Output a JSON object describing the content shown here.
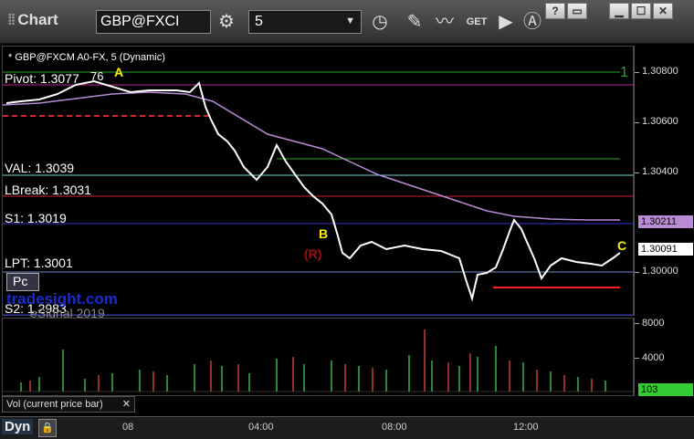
{
  "toolbar": {
    "title": "Chart",
    "symbol": "GBP@FXCI",
    "interval": "5",
    "get_label": "GET"
  },
  "chart_header": "* GBP@FXCM A0-FX, 5 (Dynamic)",
  "levels": {
    "pivot": "Pivot: 1.3077",
    "pivot_suffix": "76",
    "val": "VAL: 1.3039",
    "lbreak": "LBreak: 1.3031",
    "s1": "S1: 1.3019",
    "lpt": "LPT: 1.3001",
    "s2": "S2: 1.2983"
  },
  "annotations": {
    "a": "A",
    "b": "B",
    "c": "C",
    "r": "(R)",
    "right_one": "1",
    "pc": "Pc",
    "watermark": "tradesight.com",
    "esignal": "eSignal 2019"
  },
  "price_axis": {
    "labels": [
      "1.30800",
      "1.30600",
      "1.30400",
      "1.30000"
    ],
    "flag_purple": "1.30211",
    "flag_white": "1.30091"
  },
  "volume_axis": {
    "labels": [
      "8000",
      "4000"
    ],
    "flag": "103"
  },
  "volume_caption": "Vol (current price bar)",
  "time_axis": {
    "dyn": "Dyn",
    "labels": [
      "08",
      "04:00",
      "08:00",
      "12:00"
    ]
  },
  "colors": {
    "pivot_line": "#c0208e",
    "green_line": "#22aa22",
    "val_line": "#6fd3d3",
    "lbreak_line": "#cc2233",
    "s1_line": "#3333cc",
    "ma_line": "#b98bd6",
    "annotation_yellow": "#ffee00",
    "r_label": "#a01010"
  }
}
